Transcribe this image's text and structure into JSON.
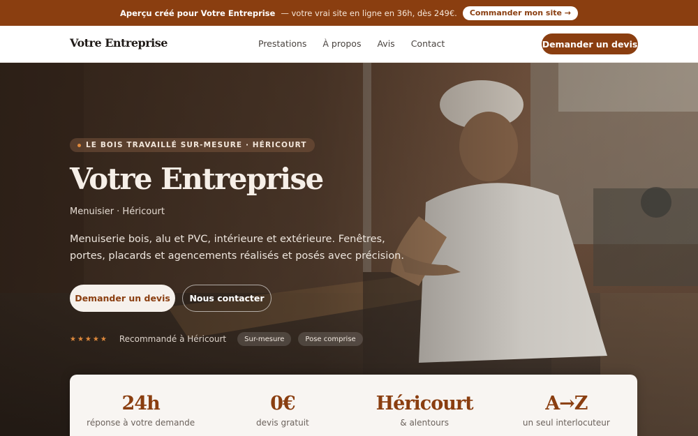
{
  "promo": {
    "strong": "Aperçu créé pour Votre Entreprise",
    "rest": "— votre vrai site en ligne en 36h, dès 249€.",
    "button": "Commander mon site →"
  },
  "nav": {
    "brand": "Votre Entreprise",
    "links": [
      "Prestations",
      "À propos",
      "Avis",
      "Contact"
    ],
    "cta": "Demander un devis"
  },
  "hero": {
    "badge": "LE BOIS TRAVAILLÉ SUR-MESURE · HÉRICOURT",
    "title": "Votre Entreprise",
    "subtitle": "Menuisier · Héricourt",
    "description": "Menuiserie bois, alu et PVC, intérieure et extérieure. Fenêtres, portes, placards et agencements réalisés et posés avec précision.",
    "primary_button": "Demander un devis",
    "secondary_button": "Nous contacter",
    "stars": "★★★★★",
    "recommendation": "Recommandé à Héricourt",
    "chips": [
      "Sur-mesure",
      "Pose comprise"
    ]
  },
  "stats": [
    {
      "value": "24h",
      "label": "réponse à votre demande"
    },
    {
      "value": "0€",
      "label": "devis gratuit"
    },
    {
      "value": "Héricourt",
      "label": "& alentours"
    },
    {
      "value": "A→Z",
      "label": "un seul interlocuteur"
    }
  ],
  "colors": {
    "brand": "#8a3e10",
    "accent_star": "#e08a3c",
    "stat_background": "#f8f5f2"
  }
}
